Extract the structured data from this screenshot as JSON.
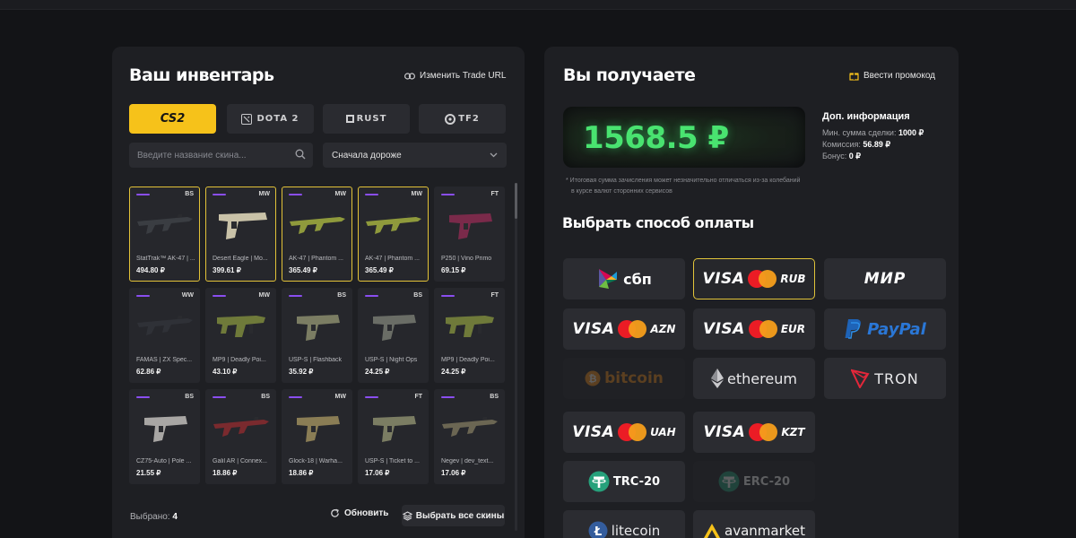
{
  "inventory": {
    "title": "Ваш инвентарь",
    "trade_url_label": "Изменить Trade URL",
    "games": [
      {
        "id": "cs2",
        "label": "CS2"
      },
      {
        "id": "dota2",
        "label": "DOTA 2"
      },
      {
        "id": "rust",
        "label": "RUST"
      },
      {
        "id": "tf2",
        "label": "TF2"
      }
    ],
    "search_placeholder": "Введите название скина...",
    "sort_value": "Сначала дороже",
    "items": [
      {
        "name": "StatTrak™ AK-47 | ...",
        "price": "494.80 ₽",
        "wear": "BS",
        "selected": true,
        "type": "rifle",
        "color": "#3a3d42"
      },
      {
        "name": "Desert Eagle | Mo...",
        "price": "399.61 ₽",
        "wear": "MW",
        "selected": true,
        "type": "deagle",
        "color": "#c9c2a8"
      },
      {
        "name": "AK-47 | Phantom ...",
        "price": "365.49 ₽",
        "wear": "MW",
        "selected": true,
        "type": "rifle",
        "color": "#8f9a3c"
      },
      {
        "name": "AK-47 | Phantom ...",
        "price": "365.49 ₽",
        "wear": "MW",
        "selected": true,
        "type": "rifle",
        "color": "#8f9a3c"
      },
      {
        "name": "P250 | Vino Primo",
        "price": "69.15 ₽",
        "wear": "FT",
        "selected": false,
        "type": "pistol",
        "color": "#7a2a4a"
      },
      {
        "name": "FAMAS | ZX Spec...",
        "price": "62.86 ₽",
        "wear": "WW",
        "selected": false,
        "type": "rifle",
        "color": "#2f3137"
      },
      {
        "name": "MP9 | Deadly Poi...",
        "price": "43.10 ₽",
        "wear": "MW",
        "selected": false,
        "type": "smg",
        "color": "#6f7a3a"
      },
      {
        "name": "USP-S | Flashback",
        "price": "35.92 ₽",
        "wear": "BS",
        "selected": false,
        "type": "pistol",
        "color": "#7b7d63"
      },
      {
        "name": "USP-S | Night Ops",
        "price": "24.25 ₽",
        "wear": "BS",
        "selected": false,
        "type": "pistol",
        "color": "#6a6d66"
      },
      {
        "name": "MP9 | Deadly Poi...",
        "price": "24.25 ₽",
        "wear": "FT",
        "selected": false,
        "type": "smg",
        "color": "#6f7a3a"
      },
      {
        "name": "CZ75-Auto | Pole ...",
        "price": "21.55 ₽",
        "wear": "BS",
        "selected": false,
        "type": "pistol",
        "color": "#a8a6a4"
      },
      {
        "name": "Galil AR | Connex...",
        "price": "18.86 ₽",
        "wear": "BS",
        "selected": false,
        "type": "rifle",
        "color": "#7a2a2e"
      },
      {
        "name": "Glock-18 | Warha...",
        "price": "18.86 ₽",
        "wear": "MW",
        "selected": false,
        "type": "pistol",
        "color": "#8a7d55"
      },
      {
        "name": "USP-S | Ticket to ...",
        "price": "17.06 ₽",
        "wear": "FT",
        "selected": false,
        "type": "pistol",
        "color": "#7b7d63"
      },
      {
        "name": "Negev | dev_text...",
        "price": "17.06 ₽",
        "wear": "BS",
        "selected": false,
        "type": "rifle",
        "color": "#6b6653"
      }
    ],
    "selected_label": "Выбрано:",
    "selected_count": "4",
    "refresh_label": "Обновить",
    "select_all_label": "Выбрать все скины"
  },
  "receive": {
    "title": "Вы получаете",
    "promo_label": "Ввести промокод",
    "amount": "1568.5 ₽",
    "info_title": "Доп. информация",
    "info": [
      {
        "label": "Мин. сумма сделки:",
        "value": "1000 ₽"
      },
      {
        "label": "Комиссия:",
        "value": "56.89 ₽"
      },
      {
        "label": "Бонус:",
        "value": "0 ₽"
      }
    ],
    "note_line1": "* Итоговая сумма зачисления может незначительно отличаться из-за колебаний",
    "note_line2": "в курсе валют сторонних сервисов",
    "pay_title": "Выбрать способ оплаты",
    "methods": [
      {
        "id": "sbp",
        "label": "сбп"
      },
      {
        "id": "visa-rub",
        "brand": "VISA",
        "currency": "RUB"
      },
      {
        "id": "mir",
        "label": "МИР"
      },
      {
        "id": "visa-azn",
        "brand": "VISA",
        "currency": "AZN"
      },
      {
        "id": "visa-eur",
        "brand": "VISA",
        "currency": "EUR"
      },
      {
        "id": "paypal",
        "label": "PayPal"
      },
      {
        "id": "bitcoin",
        "label": "bitcoin"
      },
      {
        "id": "ethereum",
        "label": "ethereum"
      },
      {
        "id": "tron",
        "label": "TRON"
      },
      {
        "id": "visa-uah",
        "brand": "VISA",
        "currency": "UAH"
      },
      {
        "id": "visa-kzt",
        "brand": "VISA",
        "currency": "KZT"
      },
      {
        "id": "trc20",
        "label": "TRC-20"
      },
      {
        "id": "erc20",
        "label": "ERC-20"
      },
      {
        "id": "litecoin",
        "label": "litecoin"
      },
      {
        "id": "avanmarket",
        "label": "avanmarket"
      }
    ]
  },
  "colors": {
    "accent": "#f6c21a",
    "amount_green": "#49e370",
    "rarity": "#8a4ef0",
    "selected_border": "#e2c238"
  }
}
